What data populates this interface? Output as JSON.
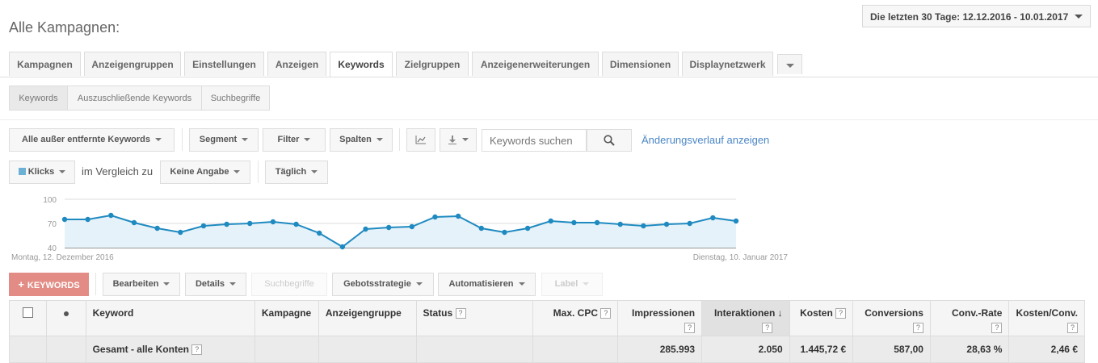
{
  "page": {
    "title": "Alle Kampagnen:"
  },
  "date_range": {
    "label": "Die letzten 30 Tage: 12.12.2016 - 10.01.2017"
  },
  "tabs": [
    {
      "label": "Kampagnen"
    },
    {
      "label": "Anzeigengruppen"
    },
    {
      "label": "Einstellungen"
    },
    {
      "label": "Anzeigen"
    },
    {
      "label": "Keywords",
      "active": true
    },
    {
      "label": "Zielgruppen"
    },
    {
      "label": "Anzeigenerweiterungen"
    },
    {
      "label": "Dimensionen"
    },
    {
      "label": "Displaynetzwerk"
    }
  ],
  "subtabs": [
    {
      "label": "Keywords",
      "active": true
    },
    {
      "label": "Auszuschließende Keywords"
    },
    {
      "label": "Suchbegriffe"
    }
  ],
  "toolbar": {
    "filter_scope": "Alle außer entfernte Keywords",
    "segment": "Segment",
    "filter": "Filter",
    "columns": "Spalten",
    "search_placeholder": "Keywords suchen",
    "history_link": "Änderungsverlauf anzeigen"
  },
  "chart_controls": {
    "metric": "Klicks",
    "compare_text": "im Vergleich zu",
    "compare_metric": "Keine Angabe",
    "interval": "Täglich"
  },
  "chart_data": {
    "type": "area",
    "series": [
      {
        "name": "Klicks",
        "color": "#1f8ac0",
        "values": [
          75,
          75,
          80,
          71,
          64,
          59,
          67,
          69,
          70,
          72,
          69,
          58,
          41,
          63,
          65,
          66,
          78,
          79,
          64,
          59,
          64,
          73,
          71,
          71,
          69,
          67,
          69,
          70,
          77,
          73
        ]
      }
    ],
    "x_start_label": "Montag, 12. Dezember 2016",
    "x_end_label": "Dienstag, 10. Januar 2017",
    "y_ticks": [
      40,
      70,
      100
    ],
    "ylim": [
      40,
      100
    ],
    "grid": true
  },
  "actions": {
    "add": "KEYWORDS",
    "edit": "Bearbeiten",
    "details": "Details",
    "search_terms": "Suchbegriffe",
    "bid_strategy": "Gebotsstrategie",
    "automate": "Automatisieren",
    "label": "Label"
  },
  "table": {
    "headers": {
      "keyword": "Keyword",
      "campaign": "Kampagne",
      "adgroup": "Anzeigengruppe",
      "status": "Status",
      "max_cpc": "Max. CPC",
      "impressions": "Impressionen",
      "interactions": "Interaktionen",
      "cost": "Kosten",
      "conversions": "Conversions",
      "conv_rate": "Conv.-Rate",
      "cost_per_conv": "Kosten/Conv."
    },
    "total": {
      "label": "Gesamt - alle Konten",
      "impressions": "285.993",
      "interactions": "2.050",
      "cost": "1.445,72 €",
      "conversions": "587,00",
      "conv_rate": "28,63 %",
      "cost_per_conv": "2,46 €"
    },
    "sort_arrow": "↓",
    "help_glyph": "?"
  }
}
